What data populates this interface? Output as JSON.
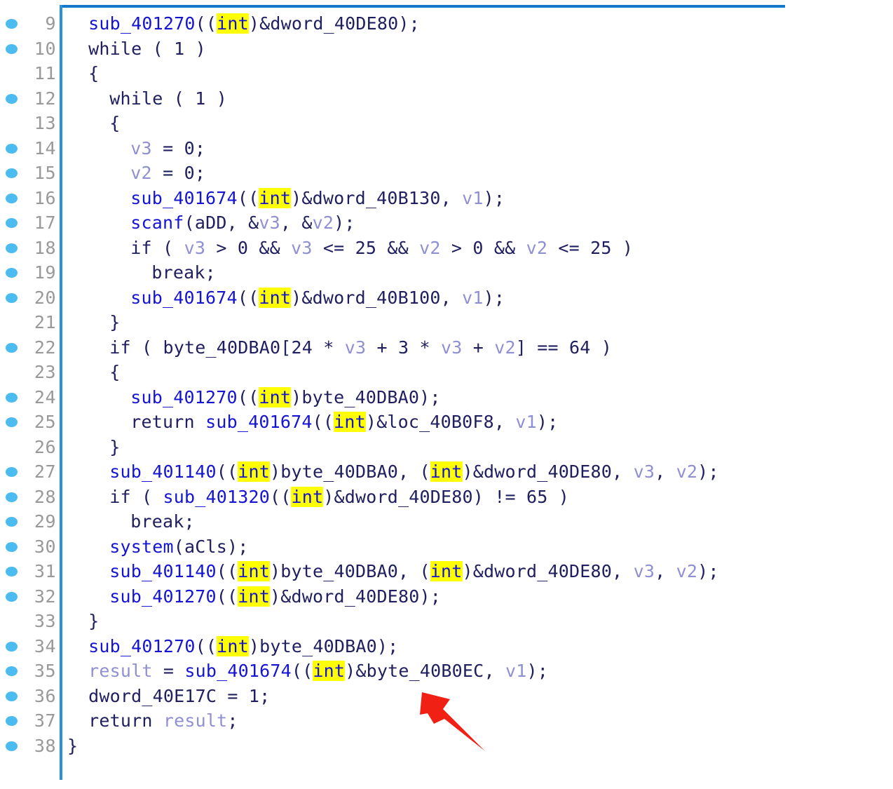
{
  "view": {
    "title": "Hex-Rays Pseudocode",
    "pane_border_color": "#1379c8",
    "breakpoint_dot_color": "#4cbcf0",
    "lineno_color": "#999999",
    "highlight_color": "#ffff00",
    "function_color": "#1414d2",
    "variable_color": "#8f8fd4",
    "default_text_color": "#202060",
    "annotation_arrow_color": "#f02014",
    "first_line": 9,
    "last_line": 38
  },
  "annotation": {
    "arrow_name": "red-arrow-pointing-to-byte_40B0EC",
    "points_at": "&byte_40B0EC"
  },
  "lines": [
    {
      "n": "9",
      "dot": true,
      "indent": 2,
      "tokens": [
        {
          "t": "sub_401270",
          "c": "fn"
        },
        {
          "t": "((",
          "c": "punc"
        },
        {
          "t": "int",
          "c": "hl"
        },
        {
          "t": ")&dword_40DE80);",
          "c": "punc"
        }
      ]
    },
    {
      "n": "10",
      "dot": true,
      "indent": 2,
      "tokens": [
        {
          "t": "while ( 1 )",
          "c": "kw"
        }
      ]
    },
    {
      "n": "11",
      "dot": false,
      "indent": 2,
      "tokens": [
        {
          "t": "{",
          "c": "punc"
        }
      ]
    },
    {
      "n": "12",
      "dot": true,
      "indent": 4,
      "tokens": [
        {
          "t": "while ( 1 )",
          "c": "kw"
        }
      ]
    },
    {
      "n": "13",
      "dot": false,
      "indent": 4,
      "tokens": [
        {
          "t": "{",
          "c": "punc"
        }
      ]
    },
    {
      "n": "14",
      "dot": true,
      "indent": 6,
      "tokens": [
        {
          "t": "v3",
          "c": "var"
        },
        {
          "t": " = 0;",
          "c": "punc"
        }
      ]
    },
    {
      "n": "15",
      "dot": true,
      "indent": 6,
      "tokens": [
        {
          "t": "v2",
          "c": "var"
        },
        {
          "t": " = 0;",
          "c": "punc"
        }
      ]
    },
    {
      "n": "16",
      "dot": true,
      "indent": 6,
      "tokens": [
        {
          "t": "sub_401674",
          "c": "fn"
        },
        {
          "t": "((",
          "c": "punc"
        },
        {
          "t": "int",
          "c": "hl"
        },
        {
          "t": ")&dword_40B130, ",
          "c": "punc"
        },
        {
          "t": "v1",
          "c": "var"
        },
        {
          "t": ");",
          "c": "punc"
        }
      ]
    },
    {
      "n": "17",
      "dot": true,
      "indent": 6,
      "tokens": [
        {
          "t": "scanf",
          "c": "fn"
        },
        {
          "t": "(aDD, &",
          "c": "punc"
        },
        {
          "t": "v3",
          "c": "var"
        },
        {
          "t": ", &",
          "c": "punc"
        },
        {
          "t": "v2",
          "c": "var"
        },
        {
          "t": ");",
          "c": "punc"
        }
      ]
    },
    {
      "n": "18",
      "dot": true,
      "indent": 6,
      "tokens": [
        {
          "t": "if ( ",
          "c": "kw"
        },
        {
          "t": "v3",
          "c": "var"
        },
        {
          "t": " > 0 && ",
          "c": "punc"
        },
        {
          "t": "v3",
          "c": "var"
        },
        {
          "t": " <= 25 && ",
          "c": "punc"
        },
        {
          "t": "v2",
          "c": "var"
        },
        {
          "t": " > 0 && ",
          "c": "punc"
        },
        {
          "t": "v2",
          "c": "var"
        },
        {
          "t": " <= 25 )",
          "c": "punc"
        }
      ]
    },
    {
      "n": "19",
      "dot": true,
      "indent": 8,
      "tokens": [
        {
          "t": "break;",
          "c": "kw"
        }
      ]
    },
    {
      "n": "20",
      "dot": true,
      "indent": 6,
      "tokens": [
        {
          "t": "sub_401674",
          "c": "fn"
        },
        {
          "t": "((",
          "c": "punc"
        },
        {
          "t": "int",
          "c": "hl"
        },
        {
          "t": ")&dword_40B100, ",
          "c": "punc"
        },
        {
          "t": "v1",
          "c": "var"
        },
        {
          "t": ");",
          "c": "punc"
        }
      ]
    },
    {
      "n": "21",
      "dot": false,
      "indent": 4,
      "tokens": [
        {
          "t": "}",
          "c": "punc"
        }
      ]
    },
    {
      "n": "22",
      "dot": true,
      "indent": 4,
      "tokens": [
        {
          "t": "if ( byte_40DBA0[24 * ",
          "c": "kw"
        },
        {
          "t": "v3",
          "c": "var"
        },
        {
          "t": " + 3 * ",
          "c": "punc"
        },
        {
          "t": "v3",
          "c": "var"
        },
        {
          "t": " + ",
          "c": "punc"
        },
        {
          "t": "v2",
          "c": "var"
        },
        {
          "t": "] == 64 )",
          "c": "punc"
        }
      ]
    },
    {
      "n": "23",
      "dot": false,
      "indent": 4,
      "tokens": [
        {
          "t": "{",
          "c": "punc"
        }
      ]
    },
    {
      "n": "24",
      "dot": true,
      "indent": 6,
      "tokens": [
        {
          "t": "sub_401270",
          "c": "fn"
        },
        {
          "t": "((",
          "c": "punc"
        },
        {
          "t": "int",
          "c": "hl"
        },
        {
          "t": ")byte_40DBA0);",
          "c": "punc"
        }
      ]
    },
    {
      "n": "25",
      "dot": true,
      "indent": 6,
      "tokens": [
        {
          "t": "return ",
          "c": "kw"
        },
        {
          "t": "sub_401674",
          "c": "fn"
        },
        {
          "t": "((",
          "c": "punc"
        },
        {
          "t": "int",
          "c": "hl"
        },
        {
          "t": ")&loc_40B0F8, ",
          "c": "punc"
        },
        {
          "t": "v1",
          "c": "var"
        },
        {
          "t": ");",
          "c": "punc"
        }
      ]
    },
    {
      "n": "26",
      "dot": false,
      "indent": 4,
      "tokens": [
        {
          "t": "}",
          "c": "punc"
        }
      ]
    },
    {
      "n": "27",
      "dot": true,
      "indent": 4,
      "tokens": [
        {
          "t": "sub_401140",
          "c": "fn"
        },
        {
          "t": "((",
          "c": "punc"
        },
        {
          "t": "int",
          "c": "hl"
        },
        {
          "t": ")byte_40DBA0, (",
          "c": "punc"
        },
        {
          "t": "int",
          "c": "hl"
        },
        {
          "t": ")&dword_40DE80, ",
          "c": "punc"
        },
        {
          "t": "v3",
          "c": "var"
        },
        {
          "t": ", ",
          "c": "punc"
        },
        {
          "t": "v2",
          "c": "var"
        },
        {
          "t": ");",
          "c": "punc"
        }
      ]
    },
    {
      "n": "28",
      "dot": true,
      "indent": 4,
      "tokens": [
        {
          "t": "if ( ",
          "c": "kw"
        },
        {
          "t": "sub_401320",
          "c": "fn"
        },
        {
          "t": "((",
          "c": "punc"
        },
        {
          "t": "int",
          "c": "hl"
        },
        {
          "t": ")&dword_40DE80) != 65 )",
          "c": "punc"
        }
      ]
    },
    {
      "n": "29",
      "dot": true,
      "indent": 6,
      "tokens": [
        {
          "t": "break;",
          "c": "kw"
        }
      ]
    },
    {
      "n": "30",
      "dot": true,
      "indent": 4,
      "tokens": [
        {
          "t": "system",
          "c": "fn"
        },
        {
          "t": "(aCls);",
          "c": "punc"
        }
      ]
    },
    {
      "n": "31",
      "dot": true,
      "indent": 4,
      "tokens": [
        {
          "t": "sub_401140",
          "c": "fn"
        },
        {
          "t": "((",
          "c": "punc"
        },
        {
          "t": "int",
          "c": "hl"
        },
        {
          "t": ")byte_40DBA0, (",
          "c": "punc"
        },
        {
          "t": "int",
          "c": "hl"
        },
        {
          "t": ")&dword_40DE80, ",
          "c": "punc"
        },
        {
          "t": "v3",
          "c": "var"
        },
        {
          "t": ", ",
          "c": "punc"
        },
        {
          "t": "v2",
          "c": "var"
        },
        {
          "t": ");",
          "c": "punc"
        }
      ]
    },
    {
      "n": "32",
      "dot": true,
      "indent": 4,
      "tokens": [
        {
          "t": "sub_401270",
          "c": "fn"
        },
        {
          "t": "((",
          "c": "punc"
        },
        {
          "t": "int",
          "c": "hl"
        },
        {
          "t": ")&dword_40DE80);",
          "c": "punc"
        }
      ]
    },
    {
      "n": "33",
      "dot": false,
      "indent": 2,
      "tokens": [
        {
          "t": "}",
          "c": "punc"
        }
      ]
    },
    {
      "n": "34",
      "dot": true,
      "indent": 2,
      "tokens": [
        {
          "t": "sub_401270",
          "c": "fn"
        },
        {
          "t": "((",
          "c": "punc"
        },
        {
          "t": "int",
          "c": "hl"
        },
        {
          "t": ")byte_40DBA0);",
          "c": "punc"
        }
      ]
    },
    {
      "n": "35",
      "dot": true,
      "indent": 2,
      "tokens": [
        {
          "t": "result",
          "c": "var"
        },
        {
          "t": " = ",
          "c": "punc"
        },
        {
          "t": "sub_401674",
          "c": "fn"
        },
        {
          "t": "((",
          "c": "punc"
        },
        {
          "t": "int",
          "c": "hl"
        },
        {
          "t": ")&byte_40B0EC, ",
          "c": "punc"
        },
        {
          "t": "v1",
          "c": "var"
        },
        {
          "t": ");",
          "c": "punc"
        }
      ]
    },
    {
      "n": "36",
      "dot": true,
      "indent": 2,
      "tokens": [
        {
          "t": "dword_40E17C = 1;",
          "c": "punc"
        }
      ]
    },
    {
      "n": "37",
      "dot": true,
      "indent": 2,
      "tokens": [
        {
          "t": "return ",
          "c": "kw"
        },
        {
          "t": "result",
          "c": "var"
        },
        {
          "t": ";",
          "c": "punc"
        }
      ]
    },
    {
      "n": "38",
      "dot": true,
      "indent": 0,
      "tokens": [
        {
          "t": "}",
          "c": "punc"
        }
      ]
    }
  ]
}
